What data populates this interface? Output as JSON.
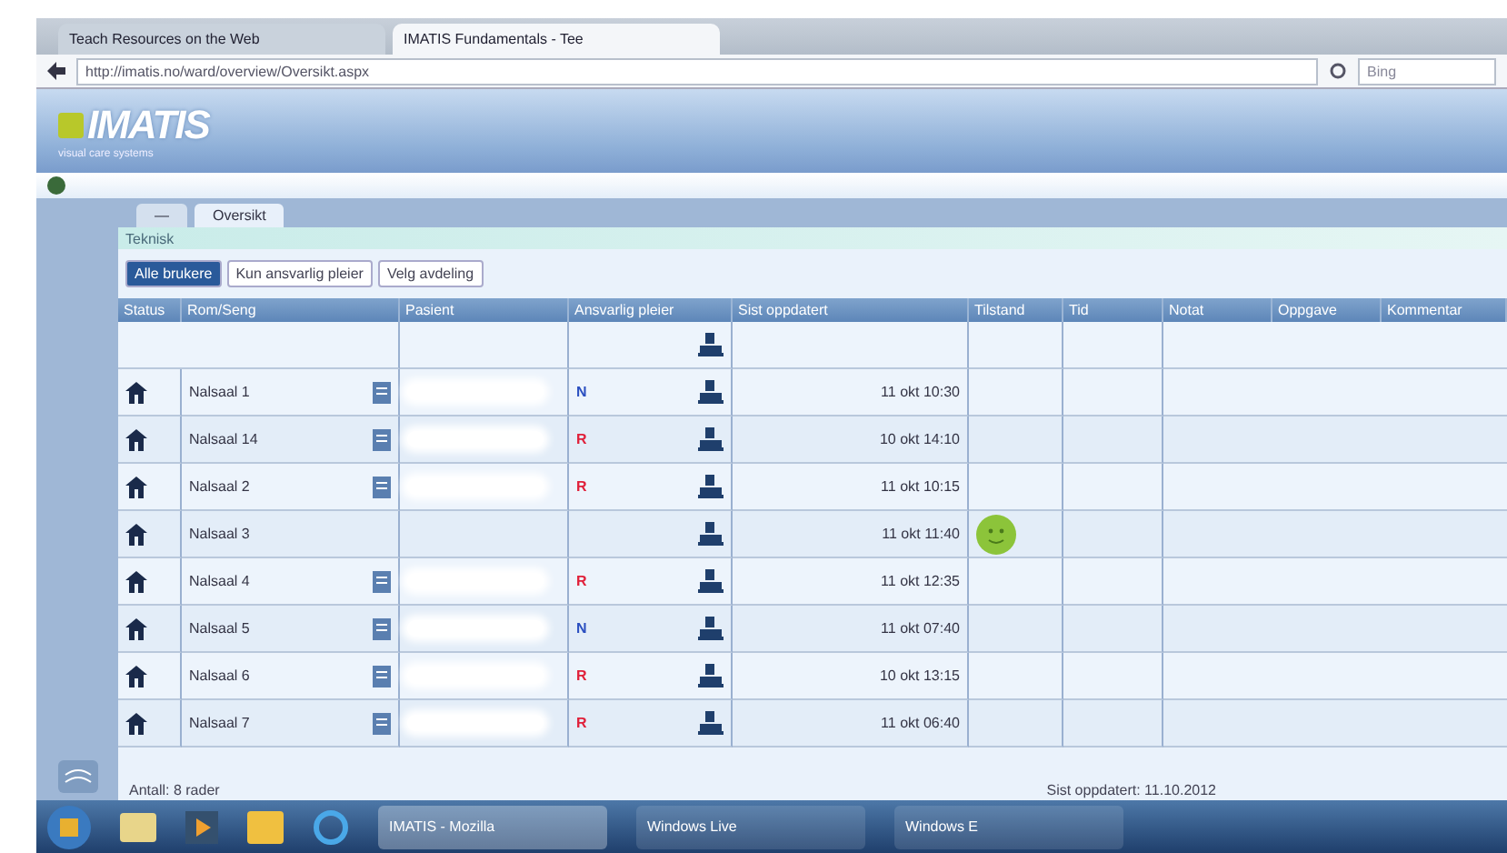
{
  "browser": {
    "tabs": [
      {
        "label": "Teach Resources on the Web",
        "selected": false
      },
      {
        "label": "IMATIS Fundamentals - Tee",
        "selected": true
      }
    ],
    "address": "http://imatis.no/ward/overview/Oversikt.aspx",
    "search_placeholder": "Bing"
  },
  "app": {
    "logo": "IMATIS",
    "logo_tagline": "visual care systems",
    "page_tabs": [
      {
        "label": "—",
        "selected": false
      },
      {
        "label": "Oversikt",
        "selected": true
      }
    ],
    "panel_title": "Teknisk",
    "filters": [
      {
        "label": "Alle brukere",
        "selected": true
      },
      {
        "label": "Kun ansvarlig pleier",
        "selected": false
      },
      {
        "label": "Velg avdeling",
        "selected": false
      }
    ],
    "columns": [
      "Status",
      "Rom/Seng",
      "Pasient",
      "Ansvarlig pleier",
      "Sist oppdatert",
      "Tilstand",
      "Tid",
      "Notat",
      "Oppgave",
      "Kommentar"
    ],
    "rows": [
      {
        "name": "Nalsaal 1",
        "document": true,
        "redacted": true,
        "flag": {
          "letter": "N",
          "color": "#2b4fc0"
        },
        "time": "11 okt 10:30",
        "mood": false
      },
      {
        "name": "Nalsaal 14",
        "document": true,
        "redacted": true,
        "flag": {
          "letter": "R",
          "color": "#e0203a"
        },
        "time": "10 okt 14:10",
        "mood": false
      },
      {
        "name": "Nalsaal 2",
        "document": true,
        "redacted": true,
        "flag": {
          "letter": "R",
          "color": "#e0203a"
        },
        "time": "11 okt 10:15",
        "mood": false
      },
      {
        "name": "Nalsaal 3",
        "document": false,
        "redacted": false,
        "time": "11 okt 11:40",
        "mood": true
      },
      {
        "name": "Nalsaal 4",
        "document": true,
        "redacted": true,
        "flag": {
          "letter": "R",
          "color": "#e0203a"
        },
        "time": "11 okt 12:35",
        "mood": false
      },
      {
        "name": "Nalsaal 5",
        "document": true,
        "redacted": true,
        "flag": {
          "letter": "N",
          "color": "#2b4fc0"
        },
        "time": "11 okt 07:40",
        "mood": false
      },
      {
        "name": "Nalsaal 6",
        "document": true,
        "redacted": true,
        "flag": {
          "letter": "R",
          "color": "#e0203a"
        },
        "time": "10 okt 13:15",
        "mood": false
      },
      {
        "name": "Nalsaal 7",
        "document": true,
        "redacted": true,
        "flag": {
          "letter": "R",
          "color": "#e0203a"
        },
        "time": "11 okt 06:40",
        "mood": false
      }
    ],
    "footer_left": "Antall: 8 rader",
    "footer_right": "Sist oppdatert: 11.10.2012"
  },
  "taskbar": {
    "tasks": [
      {
        "label": "IMATIS - Mozilla",
        "selected": true
      },
      {
        "label": "Windows Live",
        "selected": false
      },
      {
        "label": "Windows E",
        "selected": false
      }
    ]
  }
}
